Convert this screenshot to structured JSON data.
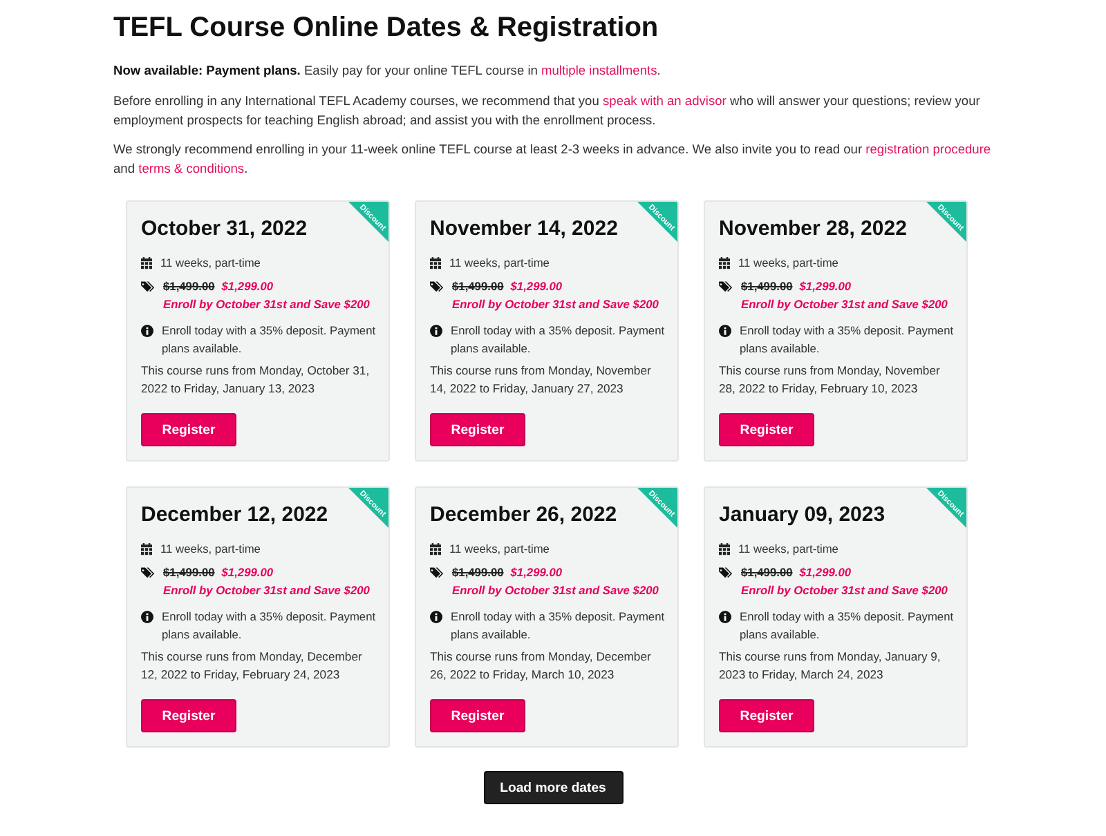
{
  "page": {
    "title": "TEFL Course Online Dates & Registration"
  },
  "intro": [
    {
      "segments": [
        {
          "kind": "bold",
          "text": "Now available: Payment plans."
        },
        {
          "kind": "text",
          "text": " Easily pay for your online TEFL course in "
        },
        {
          "kind": "link",
          "text": "multiple installments"
        },
        {
          "kind": "text",
          "text": "."
        }
      ]
    },
    {
      "segments": [
        {
          "kind": "text",
          "text": "Before enrolling in any International TEFL Academy courses, we recommend that you "
        },
        {
          "kind": "link",
          "text": "speak with an advisor"
        },
        {
          "kind": "text",
          "text": " who will answer your questions; review your employment prospects for teaching English abroad; and assist you with the enrollment process."
        }
      ]
    },
    {
      "segments": [
        {
          "kind": "text",
          "text": "We strongly recommend enrolling in your 11-week online TEFL course at least 2-3 weeks in advance. We also invite you to read our "
        },
        {
          "kind": "link",
          "text": "registration procedure"
        },
        {
          "kind": "text",
          "text": " and "
        },
        {
          "kind": "link",
          "text": "terms & conditions"
        },
        {
          "kind": "text",
          "text": "."
        }
      ]
    }
  ],
  "courses": [
    {
      "date": "October 31, 2022",
      "badge": "Discount",
      "duration": "11 weeks, part-time",
      "old_price": "$1,499.00",
      "price": "$1,299.00",
      "promo": "Enroll by October 31st and Save $200",
      "deposit_note": "Enroll today with a 35% deposit. Payment plans available.",
      "schedule": "This course runs from Monday, October 31, 2022 to Friday, January 13, 2023",
      "button": "Register"
    },
    {
      "date": "November 14, 2022",
      "badge": "Discount",
      "duration": "11 weeks, part-time",
      "old_price": "$1,499.00",
      "price": "$1,299.00",
      "promo": "Enroll by October 31st and Save $200",
      "deposit_note": "Enroll today with a 35% deposit. Payment plans available.",
      "schedule": "This course runs from Monday, November 14, 2022 to Friday, January 27, 2023",
      "button": "Register"
    },
    {
      "date": "November 28, 2022",
      "badge": "Discount",
      "duration": "11 weeks, part-time",
      "old_price": "$1,499.00",
      "price": "$1,299.00",
      "promo": "Enroll by October 31st and Save $200",
      "deposit_note": "Enroll today with a 35% deposit. Payment plans available.",
      "schedule": "This course runs from Monday, November 28, 2022 to Friday, February 10, 2023",
      "button": "Register"
    },
    {
      "date": "December 12, 2022",
      "badge": "Discount",
      "duration": "11 weeks, part-time",
      "old_price": "$1,499.00",
      "price": "$1,299.00",
      "promo": "Enroll by October 31st and Save $200",
      "deposit_note": "Enroll today with a 35% deposit. Payment plans available.",
      "schedule": "This course runs from Monday, December 12, 2022 to Friday, February 24, 2023",
      "button": "Register"
    },
    {
      "date": "December 26, 2022",
      "badge": "Discount",
      "duration": "11 weeks, part-time",
      "old_price": "$1,499.00",
      "price": "$1,299.00",
      "promo": "Enroll by October 31st and Save $200",
      "deposit_note": "Enroll today with a 35% deposit. Payment plans available.",
      "schedule": "This course runs from Monday, December 26, 2022 to Friday, March 10, 2023",
      "button": "Register"
    },
    {
      "date": "January 09, 2023",
      "badge": "Discount",
      "duration": "11 weeks, part-time",
      "old_price": "$1,499.00",
      "price": "$1,299.00",
      "promo": "Enroll by October 31st and Save $200",
      "deposit_note": "Enroll today with a 35% deposit. Payment plans available.",
      "schedule": "This course runs from Monday, January 9, 2023 to Friday, March 24, 2023",
      "button": "Register"
    }
  ],
  "load_more_button": "Load more dates"
}
